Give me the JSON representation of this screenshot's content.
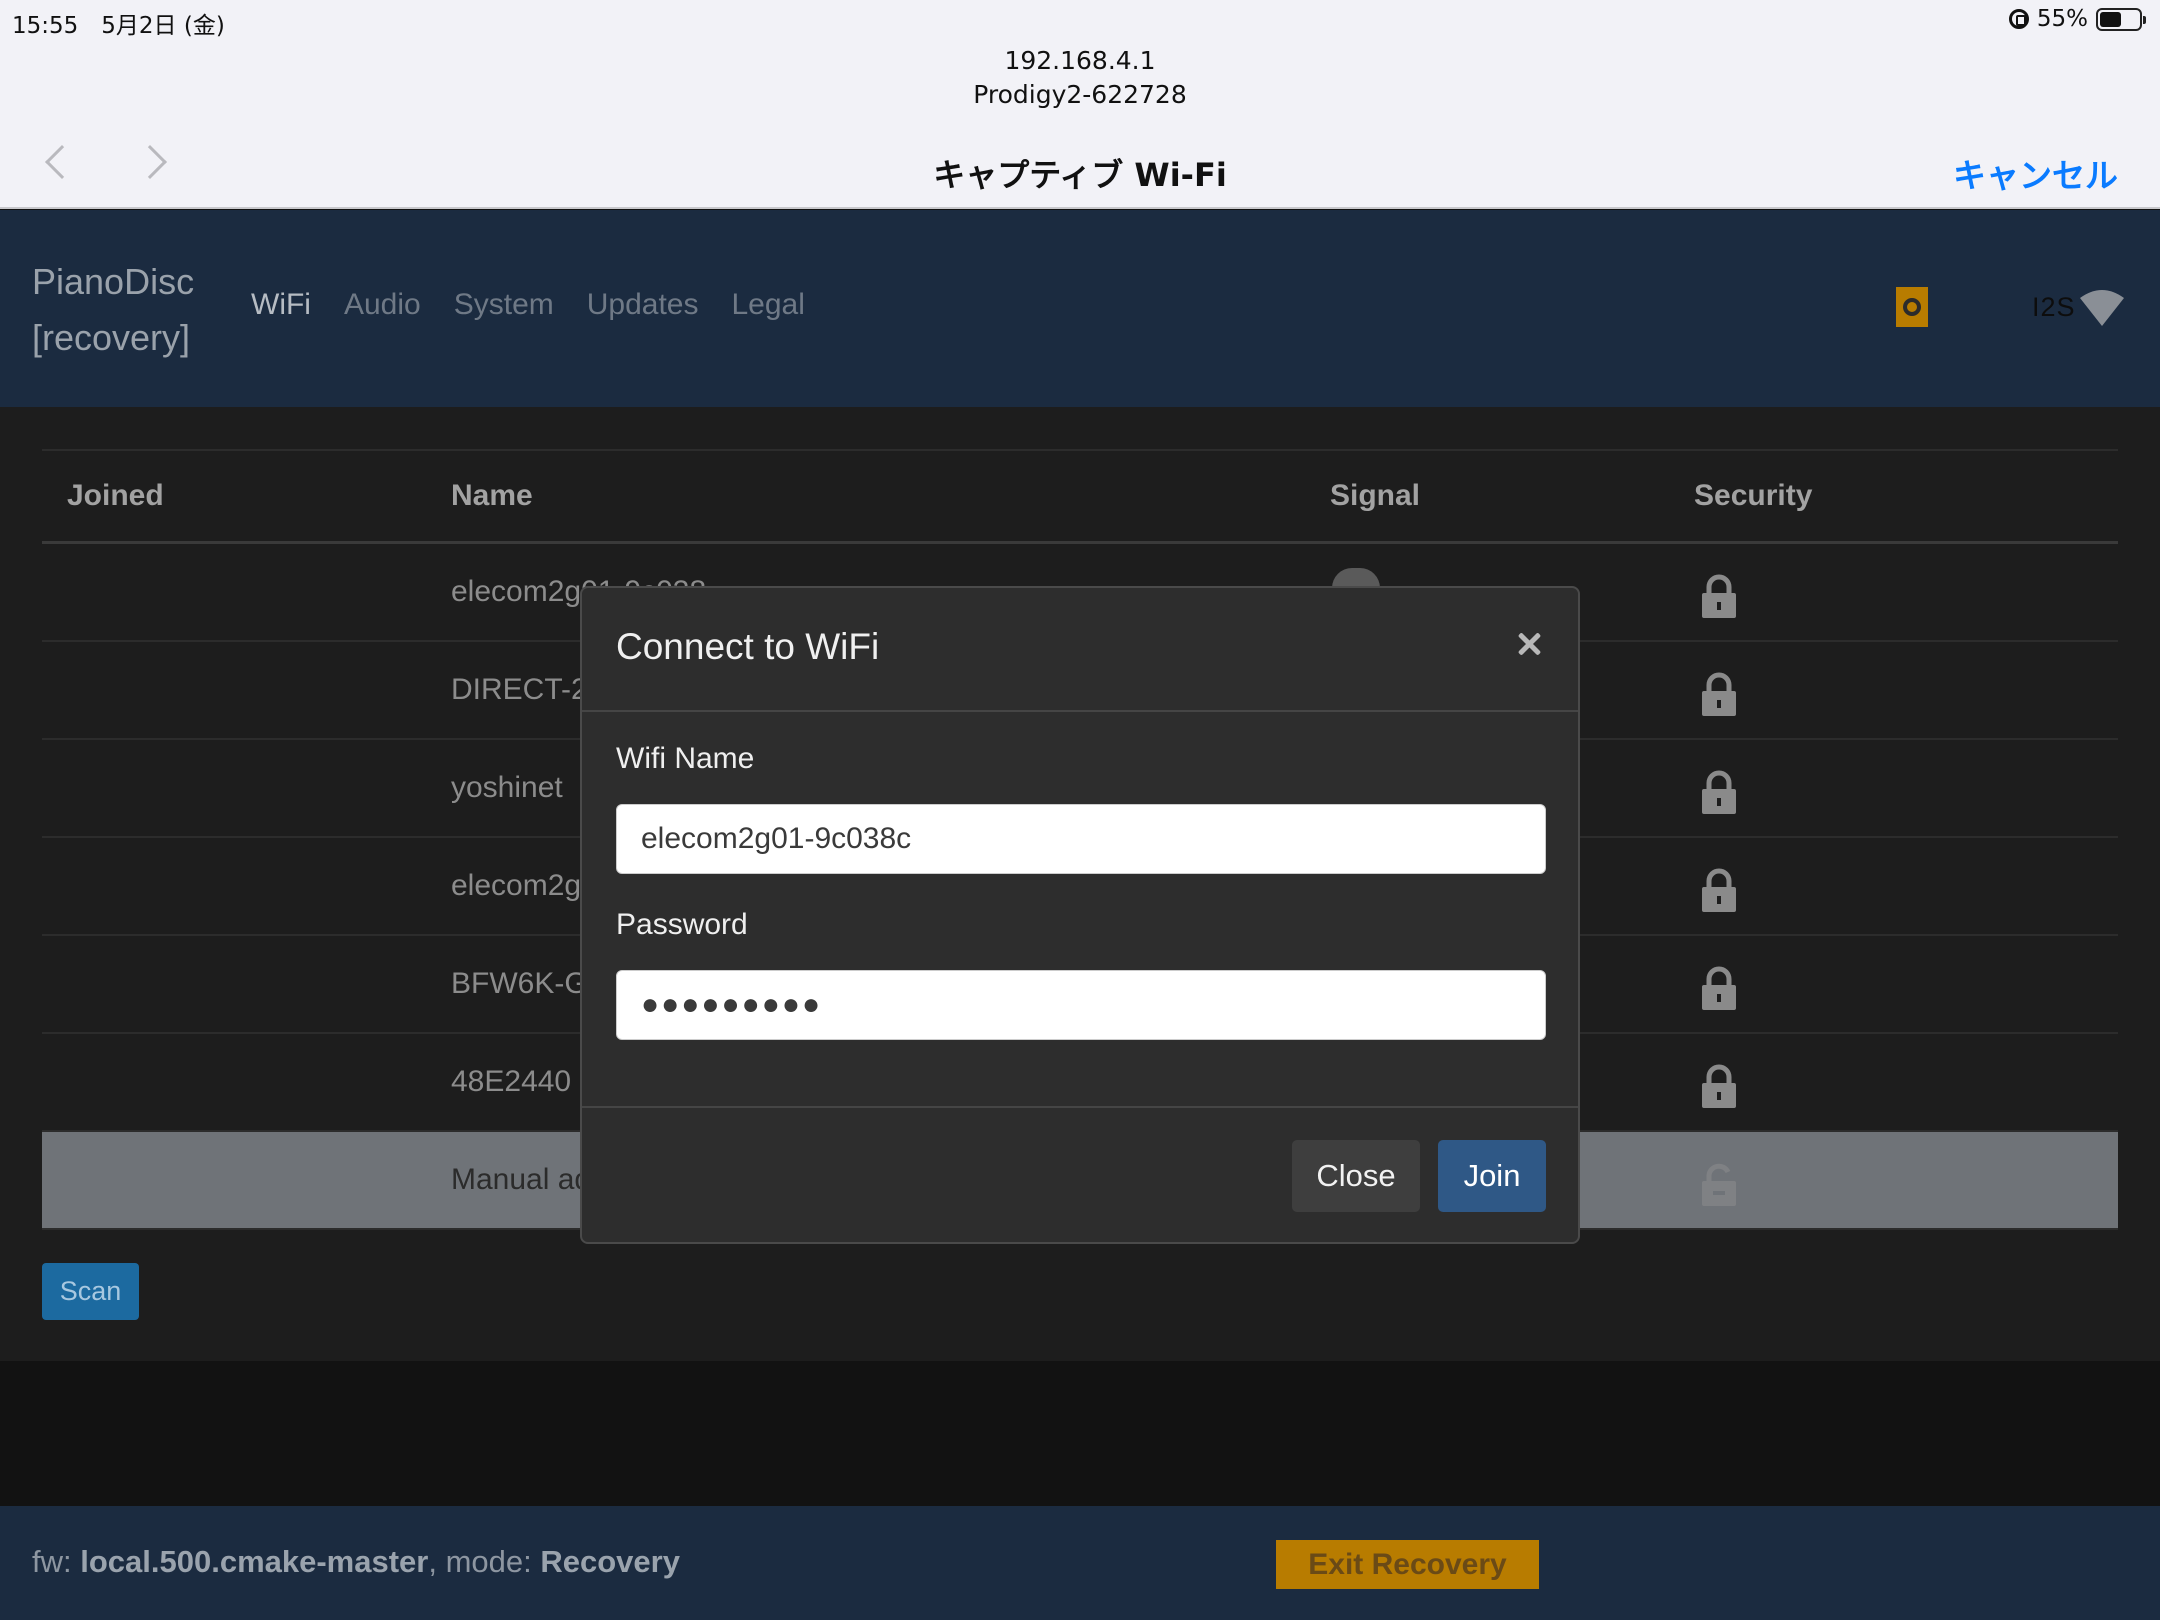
{
  "status_bar": {
    "time_date": "15:55　5月2日 (金)",
    "battery": "55%",
    "battery_level": 0.55
  },
  "captive": {
    "address": "192.168.4.1",
    "ssid": "Prodigy2-622728",
    "title": "キャプティブ Wi-Fi",
    "cancel": "キャンセル"
  },
  "app": {
    "brand_line1": "PianoDisc",
    "brand_line2": "[recovery]",
    "nav": [
      "WiFi",
      "Audio",
      "System",
      "Updates",
      "Legal"
    ],
    "active_nav": "WiFi",
    "output_label": "I2S"
  },
  "table": {
    "headers": {
      "joined": "Joined",
      "name": "Name",
      "signal": "Signal",
      "security": "Security"
    },
    "rows": [
      {
        "name": "elecom2g01-9c038",
        "locked": true
      },
      {
        "name": "DIRECT-2",
        "locked": true
      },
      {
        "name": "yoshinet",
        "locked": true
      },
      {
        "name": "elecom2g",
        "locked": true
      },
      {
        "name": "BFW6K-G",
        "locked": true
      },
      {
        "name": "48E2440",
        "locked": true
      },
      {
        "name": "Manual ad",
        "locked": false
      }
    ]
  },
  "scan_label": "Scan",
  "footer": {
    "fw_label": "fw: ",
    "fw_value": "local.500.cmake-master",
    "mode_label": ", mode: ",
    "mode_value": "Recovery",
    "exit_label": "Exit Recovery"
  },
  "modal": {
    "title": "Connect to WiFi",
    "wifi_name_label": "Wifi Name",
    "wifi_name_value": "elecom2g01-9c038c",
    "password_label": "Password",
    "password_value": "●●●●●●●●●",
    "close_label": "Close",
    "join_label": "Join"
  },
  "colors": {
    "navbar": "#1b2b40",
    "accent_blue": "#0a7bff",
    "join_button": "#2f5886",
    "exit_button": "#b87c00",
    "scan_button": "#1c6aa0"
  }
}
